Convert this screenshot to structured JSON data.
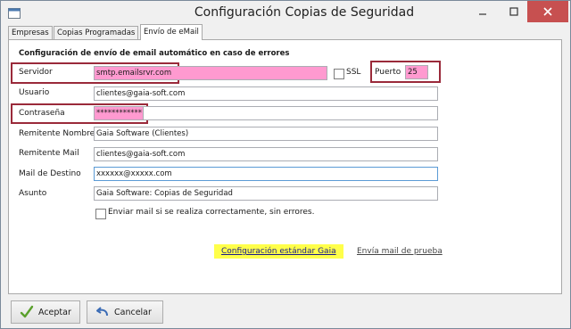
{
  "window": {
    "title": "Configuración Copias de Seguridad"
  },
  "tabs": [
    {
      "label": "Empresas"
    },
    {
      "label": "Copias Programadas"
    },
    {
      "label": "Envío de eMail"
    }
  ],
  "section": {
    "title": "Configuración de envío de email automático en caso de errores"
  },
  "form": {
    "servidor_label": "Servidor",
    "servidor_value": "smtp.emailsrvr.com",
    "ssl_label": "SSL",
    "puerto_label": "Puerto",
    "puerto_value": "25",
    "usuario_label": "Usuario",
    "usuario_value": "clientes@gaia-soft.com",
    "contrasena_label": "Contraseña",
    "contrasena_value": "************",
    "remitente_nombre_label": "Remitente Nombre",
    "remitente_nombre_value": "Gaia Software (Clientes)",
    "remitente_mail_label": "Remitente Mail",
    "remitente_mail_value": "clientes@gaia-soft.com",
    "mail_destino_label": "Mail de Destino",
    "mail_destino_value": "xxxxxx@xxxxx.com",
    "asunto_label": "Asunto",
    "asunto_value": "Gaia Software: Copias de Seguridad",
    "enviar_ok_label": "Enviar mail si se realiza correctamente, sin errores."
  },
  "links": {
    "std_config": "Configuración estándar Gaia",
    "test_mail": "Envía mail de prueba"
  },
  "buttons": {
    "accept": "Aceptar",
    "cancel": "Cancelar"
  },
  "colors": {
    "highlight_pink": "#ff9ad0",
    "highlight_border": "#9a2a3a",
    "link_highlight": "#ffff4a",
    "close_button": "#c75050"
  }
}
